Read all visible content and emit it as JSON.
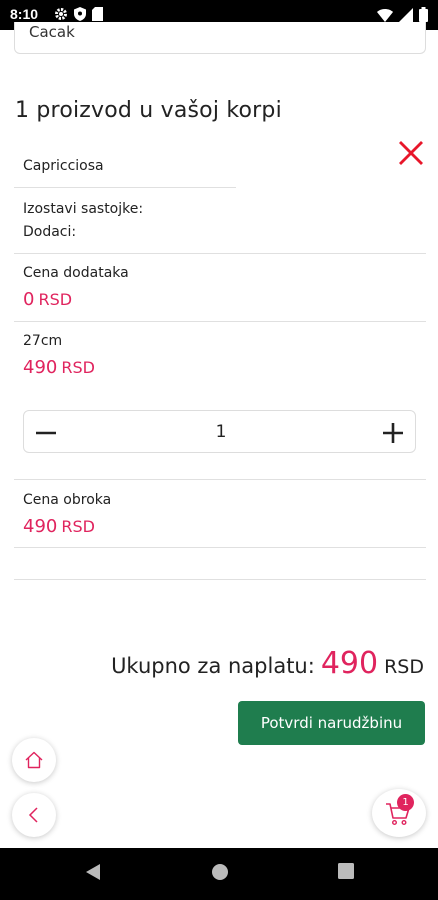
{
  "status_bar": {
    "time": "8:10"
  },
  "city_field": {
    "value": "Cacak"
  },
  "cart": {
    "heading": "1 proizvod u vašoj korpi",
    "item": {
      "name": "Capricciosa",
      "remove_label": "Izostavi sastojke:",
      "extras_label": "Dodaci:",
      "extras_price_label": "Cena dodataka",
      "extras_price_value": "0",
      "size_label": "27cm",
      "size_price_value": "490",
      "quantity": "1",
      "meal_price_label": "Cena obroka",
      "meal_price_value": "490",
      "currency": "RSD"
    },
    "total_label": "Ukupno za naplatu:",
    "total_value": "490",
    "total_currency": "RSD",
    "confirm_label": "Potvrdi narudžbinu"
  },
  "cart_fab": {
    "badge_count": "1"
  },
  "colors": {
    "accent": "#e0245e",
    "confirm": "#1f7d4e",
    "remove": "#e8162a"
  },
  "icons": [
    "settings-icon",
    "shield-icon",
    "sim-icon",
    "wifi-icon",
    "signal-icon",
    "battery-icon",
    "close-icon",
    "minus-icon",
    "plus-icon",
    "home-icon",
    "back-chevron-icon",
    "cart-icon",
    "nav-back-icon",
    "nav-home-icon",
    "nav-recents-icon"
  ]
}
